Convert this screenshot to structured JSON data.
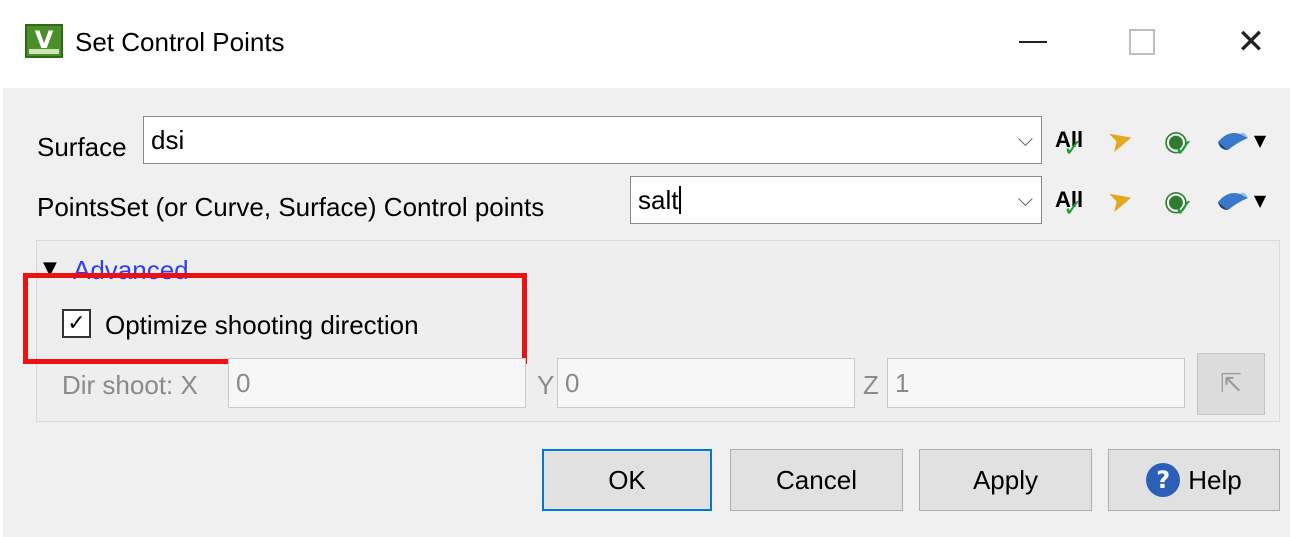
{
  "window": {
    "title": "Set Control Points",
    "app_icon": "app-logo-icon",
    "minimize_icon": "minimize-icon",
    "maximize_icon": "maximize-icon",
    "close_icon": "close-icon",
    "close_glyph": "✕"
  },
  "surface": {
    "label": "Surface",
    "value": "dsi",
    "all_label": "All"
  },
  "pointsset": {
    "label": "PointsSet (or Curve, Surface) Control points",
    "value": "salt",
    "all_label": "All"
  },
  "advanced": {
    "toggle_label": "Advanced",
    "expanded": true,
    "optimize_label": "Optimize shooting direction",
    "optimize_checked": true,
    "dir_label": "Dir shoot: X",
    "x_value": "0",
    "y_label": "Y",
    "y_value": "0",
    "z_label": "Z",
    "z_value": "1"
  },
  "buttons": {
    "ok": "OK",
    "cancel": "Cancel",
    "apply": "Apply",
    "help": "Help"
  },
  "colors": {
    "highlight": "#ee1111",
    "link": "#2d3cff",
    "ok_border": "#0078d7"
  }
}
